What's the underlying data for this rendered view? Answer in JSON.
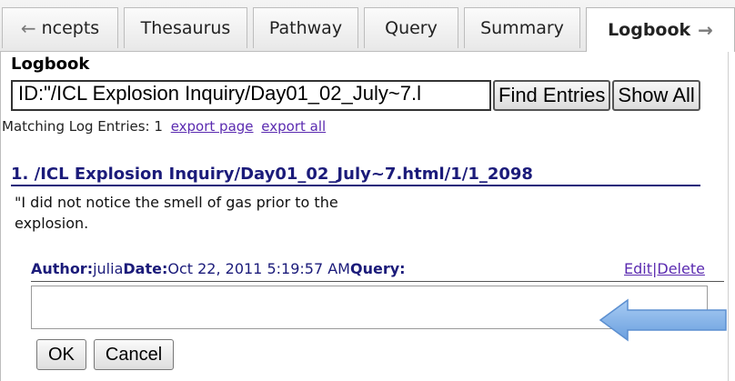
{
  "tabs": [
    {
      "label": "ncepts",
      "arrow": "←"
    },
    {
      "label": "Thesaurus"
    },
    {
      "label": "Pathway"
    },
    {
      "label": "Query"
    },
    {
      "label": "Summary"
    },
    {
      "label": "Logbook",
      "active": true,
      "arrow_right": "→"
    }
  ],
  "logbook": {
    "title": "Logbook",
    "search_value": "ID:\"/ICL Explosion Inquiry/Day01_02_July~7.l",
    "find_button": "Find Entries",
    "show_all_button": "Show All",
    "matching_label": "Matching Log Entries: 1",
    "export_page": "export page",
    "export_all": "export all"
  },
  "entry": {
    "title": "1. /ICL Explosion Inquiry/Day01_02_July~7.html/1/1_2098",
    "text": "\"I did not notice the smell of gas prior to the explosion.",
    "author_label": "Author:",
    "author_value": "julia",
    "date_label": "Date:",
    "date_value": "Oct 22, 2011 5:19:57 AM",
    "query_label": "Query:",
    "edit_link": "Edit",
    "separator": "|",
    "delete_link": "Delete",
    "query_value": ""
  },
  "actions": {
    "ok": "OK",
    "cancel": "Cancel"
  },
  "colors": {
    "accent_link": "#5b2bb0",
    "heading_blue": "#1b1b7a",
    "callout_arrow": "#7fb0e8"
  },
  "icons": {
    "tab_left": "arrow-left-icon",
    "tab_right": "arrow-right-icon",
    "callout": "arrow-left-callout-icon"
  }
}
